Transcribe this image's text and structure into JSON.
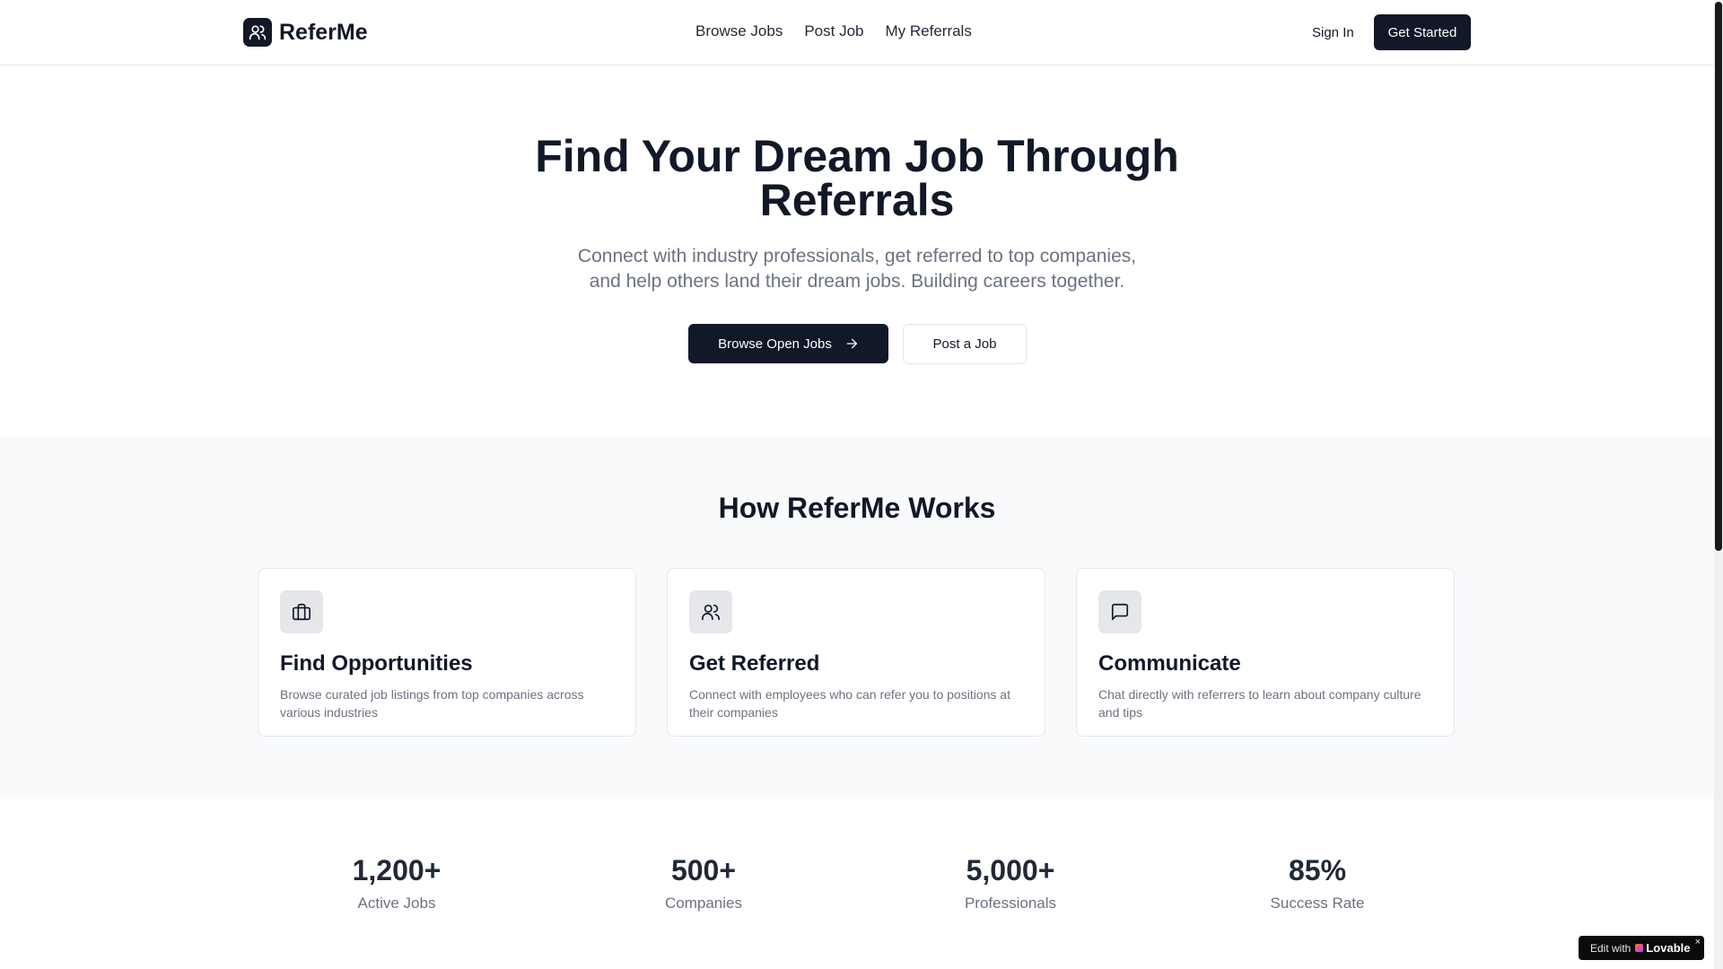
{
  "header": {
    "brand": "ReferMe",
    "nav": [
      "Browse Jobs",
      "Post Job",
      "My Referrals"
    ],
    "sign_in": "Sign In",
    "get_started": "Get Started"
  },
  "hero": {
    "title_line1": "Find Your Dream Job Through",
    "title_line2": "Referrals",
    "subtitle_line1": "Connect with industry professionals, get referred to top companies,",
    "subtitle_line2": "and help others land their dream jobs. Building careers together.",
    "primary_button": "Browse Open Jobs",
    "secondary_button": "Post a Job"
  },
  "how": {
    "title": "How ReferMe Works",
    "cards": [
      {
        "icon": "briefcase-icon",
        "title": "Find Opportunities",
        "desc": "Browse curated job listings from top companies across various industries"
      },
      {
        "icon": "users-icon",
        "title": "Get Referred",
        "desc": "Connect with employees who can refer you to positions at their companies"
      },
      {
        "icon": "message-icon",
        "title": "Communicate",
        "desc": "Chat directly with referrers to learn about company culture and tips"
      }
    ]
  },
  "stats": [
    {
      "value": "1,200+",
      "label": "Active Jobs"
    },
    {
      "value": "500+",
      "label": "Companies"
    },
    {
      "value": "5,000+",
      "label": "Professionals"
    },
    {
      "value": "85%",
      "label": "Success Rate"
    }
  ],
  "badge": {
    "prefix": "Edit with",
    "brand": "Lovable",
    "close": "×"
  },
  "colors": {
    "primary": "#111827",
    "muted_text": "#6b7280",
    "section_bg": "#f8fafc",
    "border": "#e5e7eb"
  }
}
